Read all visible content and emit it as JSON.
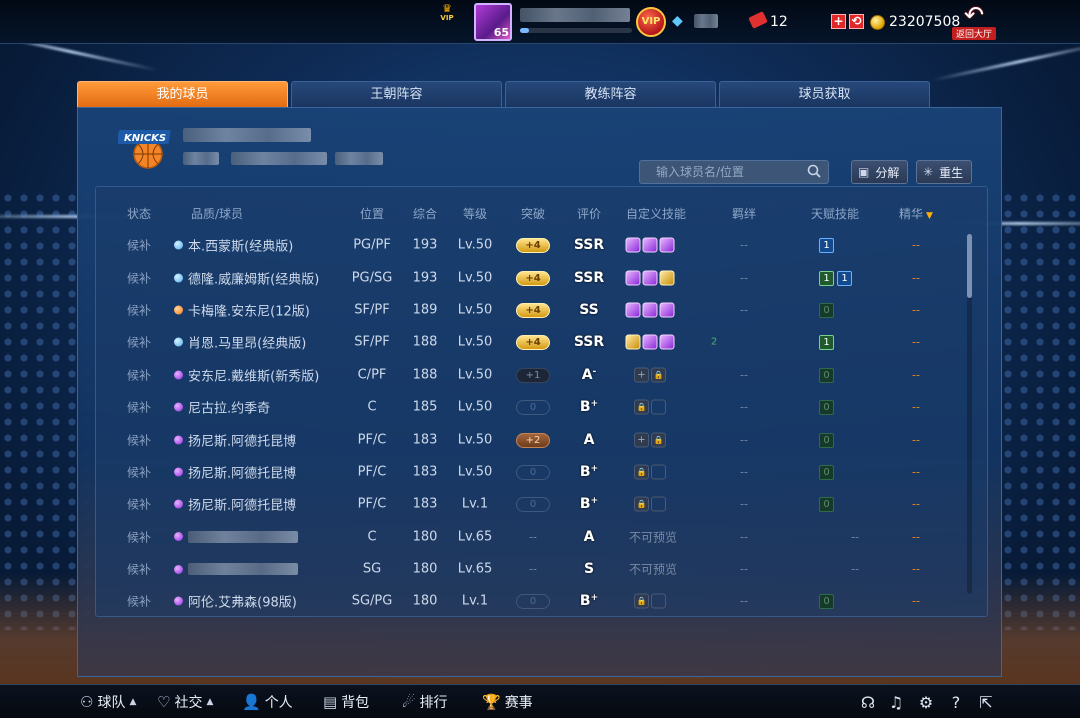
{
  "top": {
    "level": "65",
    "vip_label": "VIP",
    "small_vip_label": "VIP",
    "tickets": "12",
    "coins": "23207508",
    "back_label": "返回大厅"
  },
  "tabs": [
    {
      "label": "我的球员",
      "active": true
    },
    {
      "label": "王朝阵容",
      "active": false
    },
    {
      "label": "教练阵容",
      "active": false
    },
    {
      "label": "球员获取",
      "active": false
    }
  ],
  "team": {
    "logo_text": "KNICKS"
  },
  "search": {
    "placeholder": "输入球员名/位置"
  },
  "buttons": {
    "decompose": "分解",
    "rebirth": "重生"
  },
  "columns": {
    "status": "状态",
    "player": "品质/球员",
    "position": "位置",
    "overall": "综合",
    "level": "等级",
    "breakthrough": "突破",
    "rating": "评价",
    "skills": "自定义技能",
    "bond": "羁绊",
    "talent": "天赋技能",
    "essence": "精华"
  },
  "rows": [
    {
      "status": "候补",
      "quality": "blue",
      "name": "本.西蒙斯(经典版)",
      "pos": "PG/PF",
      "ovr": "193",
      "lvl": "Lv.50",
      "break": "+4",
      "break_style": "gold",
      "rating": "SSR",
      "rating_sup": "",
      "skills": [
        "p",
        "p",
        "p"
      ],
      "bond": "--",
      "talent": [
        "1"
      ],
      "talent_style": "blue",
      "essence": "--"
    },
    {
      "status": "候补",
      "quality": "blue",
      "name": "德隆.威廉姆斯(经典版)",
      "pos": "PG/SG",
      "ovr": "193",
      "lvl": "Lv.50",
      "break": "+4",
      "break_style": "gold",
      "rating": "SSR",
      "rating_sup": "",
      "skills": [
        "p",
        "p",
        "g"
      ],
      "bond": "--",
      "talent": [
        "1",
        "1"
      ],
      "talent_style": "mixed",
      "essence": "--"
    },
    {
      "status": "候补",
      "quality": "orange",
      "name": "卡梅隆.安东尼(12版)",
      "pos": "SF/PF",
      "ovr": "189",
      "lvl": "Lv.50",
      "break": "+4",
      "break_style": "gold",
      "rating": "SS",
      "rating_sup": "",
      "skills": [
        "p",
        "p",
        "p"
      ],
      "bond": "--",
      "talent": [
        "0"
      ],
      "talent_style": "zero",
      "essence": "--"
    },
    {
      "status": "候补",
      "quality": "blue",
      "name": "肖恩.马里昂(经典版)",
      "pos": "SF/PF",
      "ovr": "188",
      "lvl": "Lv.50",
      "break": "+4",
      "break_style": "gold",
      "rating": "SSR",
      "rating_sup": "",
      "skills": [
        "g",
        "p",
        "p"
      ],
      "bond": "2",
      "talent": [
        "1"
      ],
      "talent_style": "green",
      "essence": "--"
    },
    {
      "status": "候补",
      "quality": "purple",
      "name": "安东尼.戴维斯(新秀版)",
      "pos": "C/PF",
      "ovr": "188",
      "lvl": "Lv.50",
      "break": "+1",
      "break_style": "dark",
      "rating": "A",
      "rating_sup": "-",
      "skills": [
        "plus",
        "lock"
      ],
      "bond": "--",
      "talent": [
        "0"
      ],
      "talent_style": "zero",
      "essence": "--"
    },
    {
      "status": "候补",
      "quality": "purple",
      "name": "尼古拉.约季奇",
      "pos": "C",
      "ovr": "185",
      "lvl": "Lv.50",
      "break": "0",
      "break_style": "empty",
      "rating": "B",
      "rating_sup": "+",
      "skills": [
        "lock",
        "blank"
      ],
      "bond": "--",
      "talent": [
        "0"
      ],
      "talent_style": "zero",
      "essence": "--"
    },
    {
      "status": "候补",
      "quality": "purple",
      "name": "扬尼斯.阿德托昆博",
      "pos": "PF/C",
      "ovr": "183",
      "lvl": "Lv.50",
      "break": "+2",
      "break_style": "bronze",
      "rating": "A",
      "rating_sup": "",
      "skills": [
        "plus",
        "lock"
      ],
      "bond": "--",
      "talent": [
        "0"
      ],
      "talent_style": "zero",
      "essence": "--"
    },
    {
      "status": "候补",
      "quality": "purple",
      "name": "扬尼斯.阿德托昆博",
      "pos": "PF/C",
      "ovr": "183",
      "lvl": "Lv.50",
      "break": "0",
      "break_style": "empty",
      "rating": "B",
      "rating_sup": "+",
      "skills": [
        "lock",
        "blank"
      ],
      "bond": "--",
      "talent": [
        "0"
      ],
      "talent_style": "zero",
      "essence": "--"
    },
    {
      "status": "候补",
      "quality": "purple",
      "name": "扬尼斯.阿德托昆博",
      "pos": "PF/C",
      "ovr": "183",
      "lvl": "Lv.1",
      "break": "0",
      "break_style": "empty",
      "rating": "B",
      "rating_sup": "+",
      "skills": [
        "lock",
        "blank"
      ],
      "bond": "--",
      "talent": [
        "0"
      ],
      "talent_style": "zero",
      "essence": "--"
    },
    {
      "status": "候补",
      "quality": "purple",
      "name": "",
      "pos": "C",
      "ovr": "180",
      "lvl": "Lv.65",
      "break": "--",
      "break_style": "text",
      "rating": "A",
      "rating_sup": "",
      "skills_text": "不可预览",
      "bond": "--",
      "talent_text": "--",
      "essence": "--"
    },
    {
      "status": "候补",
      "quality": "purple",
      "name": "",
      "pos": "SG",
      "ovr": "180",
      "lvl": "Lv.65",
      "break": "--",
      "break_style": "text",
      "rating": "S",
      "rating_sup": "",
      "skills_text": "不可预览",
      "bond": "--",
      "talent_text": "--",
      "essence": "--"
    },
    {
      "status": "候补",
      "quality": "purple",
      "name": "阿伦.艾弗森(98版)",
      "pos": "SG/PG",
      "ovr": "180",
      "lvl": "Lv.1",
      "break": "0",
      "break_style": "empty",
      "rating": "B",
      "rating_sup": "+",
      "skills": [
        "lock",
        "blank"
      ],
      "bond": "--",
      "talent": [
        "0"
      ],
      "talent_style": "zero",
      "essence": "--"
    }
  ],
  "bottom_nav": {
    "team": "球队",
    "social": "社交",
    "personal": "个人",
    "bag": "背包",
    "ranking": "排行",
    "events": "赛事"
  }
}
